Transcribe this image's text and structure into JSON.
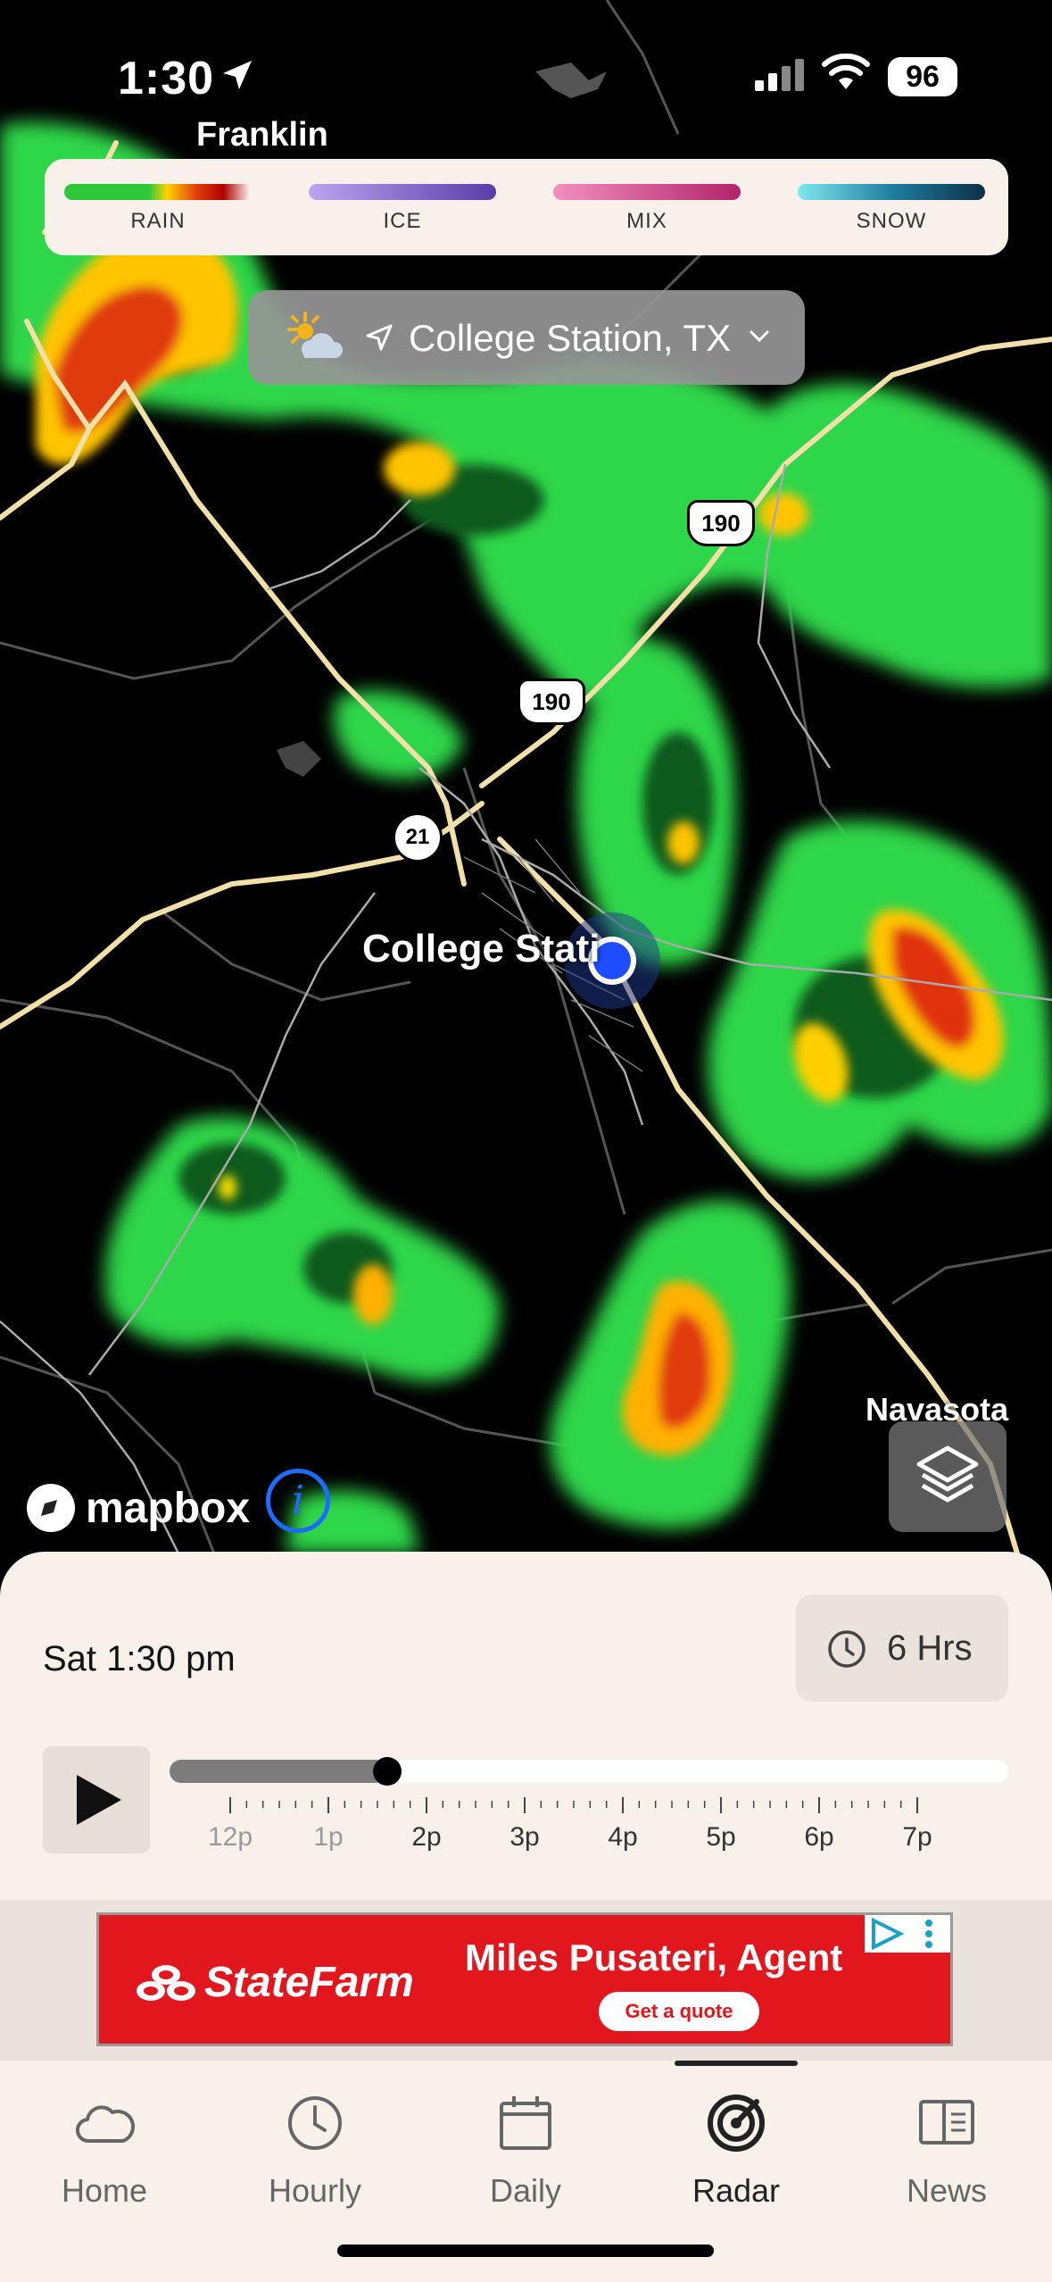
{
  "status_bar": {
    "time": "1:30",
    "battery": "96"
  },
  "map": {
    "city_labels": {
      "franklin": "Franklin",
      "college_station": "College Stati",
      "navasota": "Navasota"
    },
    "road_shields": {
      "us190_a": "190",
      "us190_b": "190",
      "sh21": "21"
    },
    "attribution": "mapbox",
    "info_label": "i"
  },
  "legend": {
    "items": [
      {
        "label": "RAIN"
      },
      {
        "label": "ICE"
      },
      {
        "label": "MIX"
      },
      {
        "label": "SNOW"
      }
    ]
  },
  "location": {
    "name": "College Station, TX",
    "weather_icon": "partly-cloudy-night-icon"
  },
  "playback": {
    "current_time": "Sat 1:30 pm",
    "range_label": "6 Hrs",
    "progress": 0.26,
    "tick_labels": [
      "12p",
      "1p",
      "2p",
      "3p",
      "4p",
      "5p",
      "6p",
      "7p"
    ],
    "past_tick_count": 2
  },
  "ad": {
    "brand": "StateFarm",
    "agent": "Miles Pusateri, Agent",
    "cta": "Get a quote"
  },
  "tabs": [
    {
      "label": "Home",
      "icon": "cloud-icon",
      "active": false
    },
    {
      "label": "Hourly",
      "icon": "clock-icon",
      "active": false
    },
    {
      "label": "Daily",
      "icon": "calendar-icon",
      "active": false
    },
    {
      "label": "Radar",
      "icon": "radar-icon",
      "active": true
    },
    {
      "label": "News",
      "icon": "news-icon",
      "active": false
    }
  ],
  "colors": {
    "accent_location": "#1e4dff",
    "ad_red": "#e2161d",
    "sheet_bg": "#f7f1ea"
  }
}
